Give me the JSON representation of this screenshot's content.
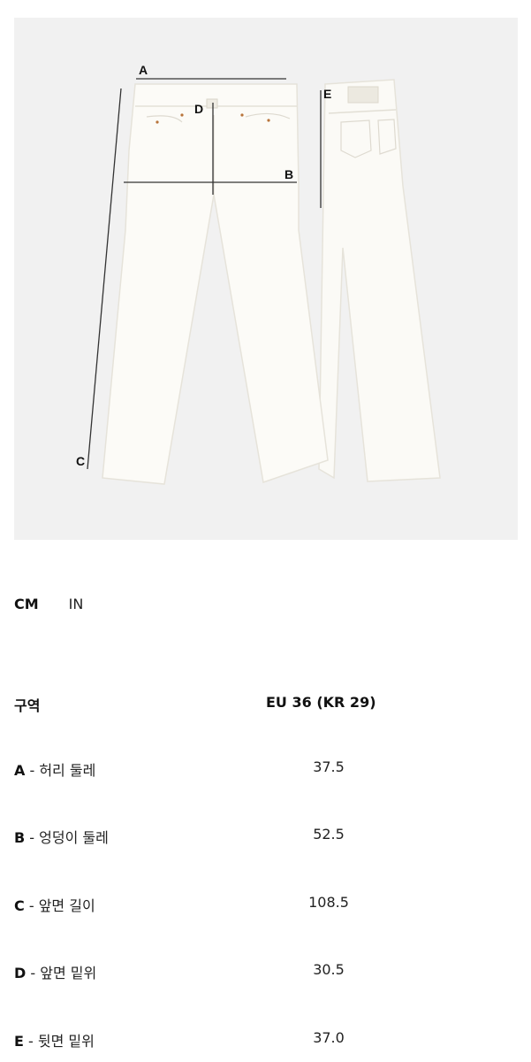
{
  "figure": {
    "letters": [
      "A",
      "B",
      "C",
      "D",
      "E"
    ]
  },
  "units": {
    "cm": "CM",
    "in": "IN",
    "selected": "CM"
  },
  "table": {
    "header_label": "구역",
    "header_size": "EU 36 (KR 29)",
    "rows": [
      {
        "letter": "A",
        "desc": " - 허리 둘레",
        "value": "37.5"
      },
      {
        "letter": "B",
        "desc": " - 엉덩이 둘레",
        "value": "52.5"
      },
      {
        "letter": "C",
        "desc": " - 앞면 길이",
        "value": "108.5"
      },
      {
        "letter": "D",
        "desc": " - 앞면 밑위",
        "value": "30.5"
      },
      {
        "letter": "E",
        "desc": " - 뒷면 밑위",
        "value": "37.0"
      }
    ]
  }
}
